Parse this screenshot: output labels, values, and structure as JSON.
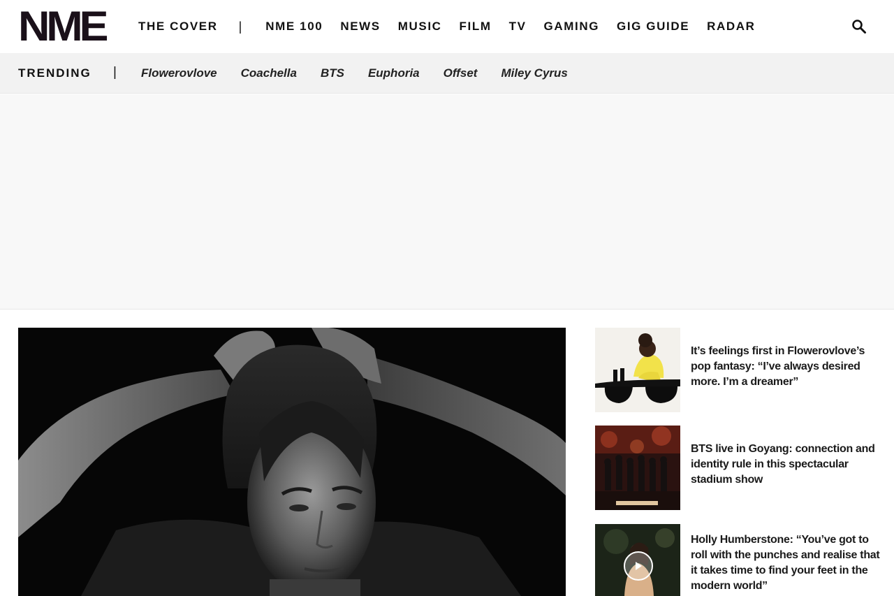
{
  "brand": {
    "logo_text": "NME"
  },
  "nav": {
    "items": [
      {
        "label": "THE COVER"
      },
      {
        "label": "|"
      },
      {
        "label": "NME 100"
      },
      {
        "label": "NEWS"
      },
      {
        "label": "MUSIC"
      },
      {
        "label": "FILM"
      },
      {
        "label": "TV"
      },
      {
        "label": "GAMING"
      },
      {
        "label": "GIG GUIDE"
      },
      {
        "label": "RADAR"
      }
    ],
    "search_icon": "search-icon"
  },
  "trending": {
    "label": "TRENDING",
    "separator": "|",
    "links": [
      "Flowerovlove",
      "Coachella",
      "BTS",
      "Euphoria",
      "Offset",
      "Miley Cyrus"
    ]
  },
  "side_articles": [
    {
      "title": "It’s feelings first in Flowerovlove’s pop fantasy: “I’ve always desired more. I’m a dreamer”",
      "thumb_icon": "article-thumbnail"
    },
    {
      "title": "BTS live in Goyang: connection and identity rule in this spectacular stadium show",
      "thumb_icon": "article-thumbnail"
    },
    {
      "title": "Holly Humberstone: “You’ve got to roll with the punches and realise that it takes time to find your feet in the modern world”",
      "thumb_icon": "play-icon"
    }
  ],
  "colors": {
    "logo": "#1a1019",
    "trending_bg": "#f2f2f2",
    "ad_bg": "#f8f8f8"
  }
}
